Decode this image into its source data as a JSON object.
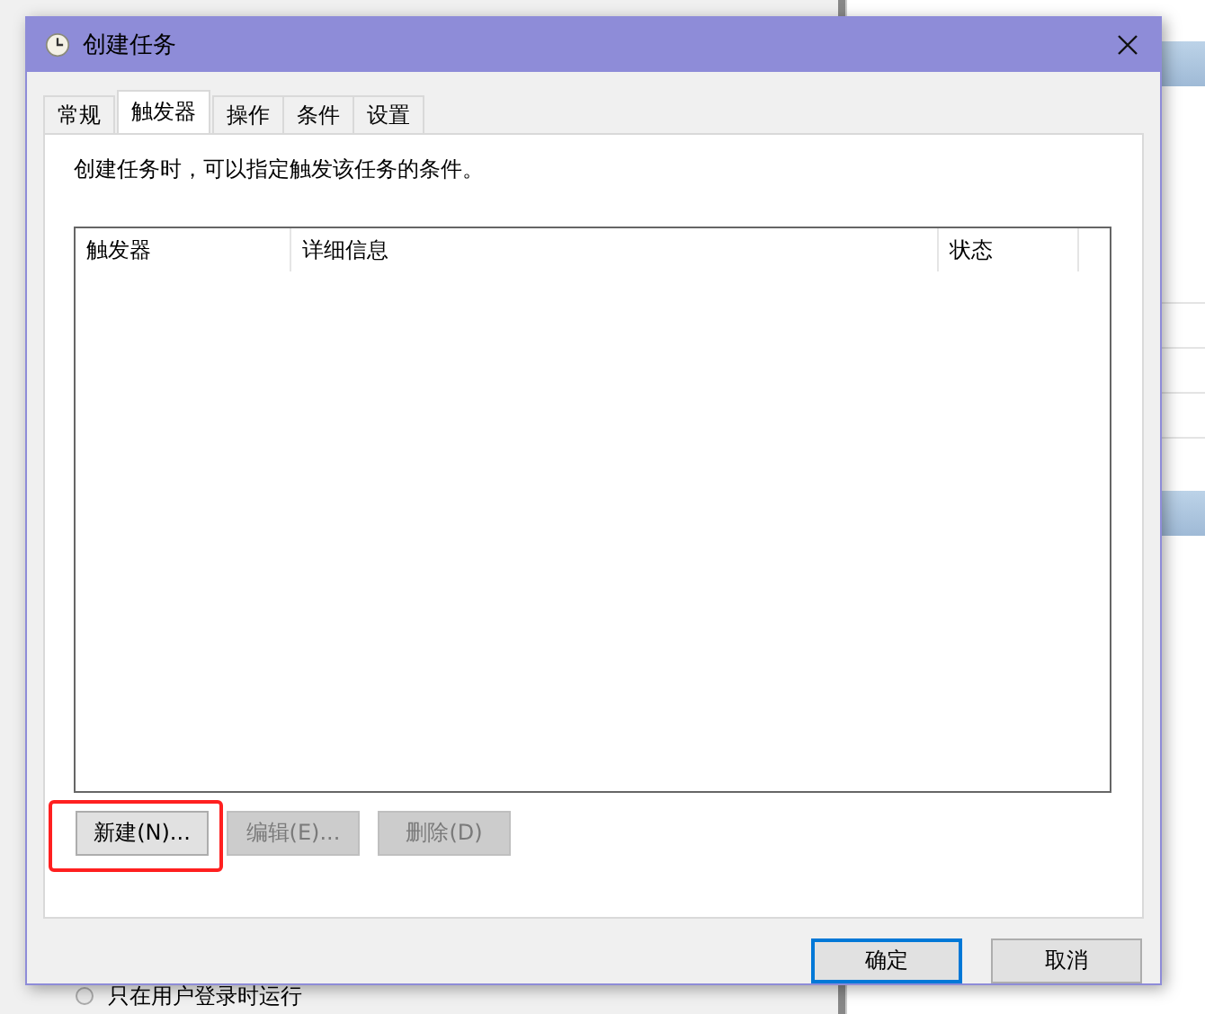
{
  "background": {
    "radio": {
      "label": "只在用户登录时运行",
      "selected": false
    }
  },
  "window": {
    "title": "创建任务"
  },
  "tabs": [
    {
      "label": "常规",
      "selected": false
    },
    {
      "label": "触发器",
      "selected": true
    },
    {
      "label": "操作",
      "selected": false
    },
    {
      "label": "条件",
      "selected": false
    },
    {
      "label": "设置",
      "selected": false
    }
  ],
  "description": "创建任务时，可以指定触发该任务的条件。",
  "table": {
    "columns": [
      "触发器",
      "详细信息",
      "状态"
    ]
  },
  "list_buttons": [
    {
      "label": "新建(N)...",
      "disabled": false,
      "highlighted": true
    },
    {
      "label": "编辑(E)...",
      "disabled": true,
      "highlighted": false
    },
    {
      "label": "删除(D)",
      "disabled": true,
      "highlighted": false
    }
  ],
  "dialog_buttons": [
    {
      "label": "确定",
      "default": true
    },
    {
      "label": "取消",
      "default": false
    }
  ]
}
